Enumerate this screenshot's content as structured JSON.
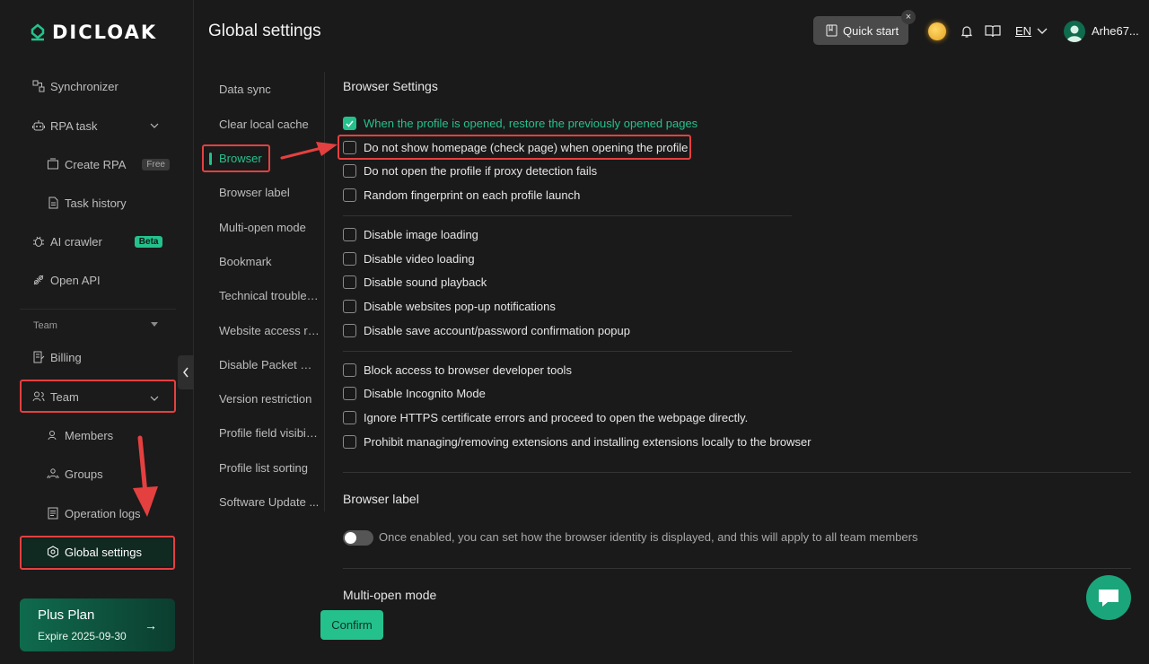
{
  "brand": {
    "name": "DICLOAK"
  },
  "header": {
    "title": "Global settings",
    "quick_start": "Quick start",
    "close_glyph": "×",
    "language": "EN",
    "username": "Arhe67..."
  },
  "sidebar": {
    "items": [
      {
        "label": "Synchronizer",
        "icon": "sync-icon"
      },
      {
        "label": "RPA task",
        "icon": "robot-icon"
      },
      {
        "label": "Create RPA",
        "icon": "create-icon",
        "badge": "Free"
      },
      {
        "label": "Task history",
        "icon": "history-icon"
      },
      {
        "label": "AI crawler",
        "icon": "bug-icon",
        "badge": "Beta"
      },
      {
        "label": "Open API",
        "icon": "api-icon"
      }
    ],
    "team_section": "Team",
    "team_items": [
      {
        "label": "Billing",
        "icon": "billing-icon"
      },
      {
        "label": "Team",
        "icon": "team-icon"
      },
      {
        "label": "Members",
        "icon": "members-icon"
      },
      {
        "label": "Groups",
        "icon": "groups-icon"
      },
      {
        "label": "Operation logs",
        "icon": "logs-icon"
      },
      {
        "label": "Global settings",
        "icon": "settings-icon"
      }
    ],
    "plan": {
      "title": "Plus Plan",
      "expire": "Expire 2025-09-30",
      "arrow": "→"
    }
  },
  "subnav": [
    "Data sync",
    "Clear local cache",
    "Browser",
    "Browser label",
    "Multi-open mode",
    "Bookmark",
    "Technical troubles...",
    "Website access re...",
    "Disable Packet Ca...",
    "Version restriction",
    "Profile field visibili...",
    "Profile list sorting",
    "Software Update ..."
  ],
  "browser_settings": {
    "title": "Browser Settings",
    "group1": [
      {
        "label": "When the profile is opened, restore the previously opened pages",
        "checked": true
      },
      {
        "label": "Do not show homepage (check page) when opening the profile",
        "checked": false
      },
      {
        "label": "Do not open the profile if proxy detection fails",
        "checked": false
      },
      {
        "label": "Random fingerprint on each profile launch",
        "checked": false
      }
    ],
    "group2": [
      {
        "label": "Disable image loading",
        "checked": false
      },
      {
        "label": "Disable video loading",
        "checked": false
      },
      {
        "label": "Disable sound playback",
        "checked": false
      },
      {
        "label": "Disable websites pop-up notifications",
        "checked": false
      },
      {
        "label": "Disable save account/password confirmation popup",
        "checked": false
      }
    ],
    "group3": [
      {
        "label": "Block access to browser developer tools",
        "checked": false
      },
      {
        "label": "Disable Incognito Mode",
        "checked": false
      },
      {
        "label": "Ignore HTTPS certificate errors and proceed to open the webpage directly.",
        "checked": false
      },
      {
        "label": "Prohibit managing/removing extensions and installing extensions locally to the browser",
        "checked": false
      }
    ]
  },
  "browser_label": {
    "title": "Browser label",
    "toggle_text": "Once enabled, you can set how the browser identity is displayed, and this will apply to all team members",
    "enabled": false
  },
  "multi_open": {
    "title": "Multi-open mode"
  },
  "confirm_label": "Confirm",
  "colors": {
    "accent": "#25c18d",
    "highlight": "#e44040",
    "background": "#1a1a1a"
  }
}
